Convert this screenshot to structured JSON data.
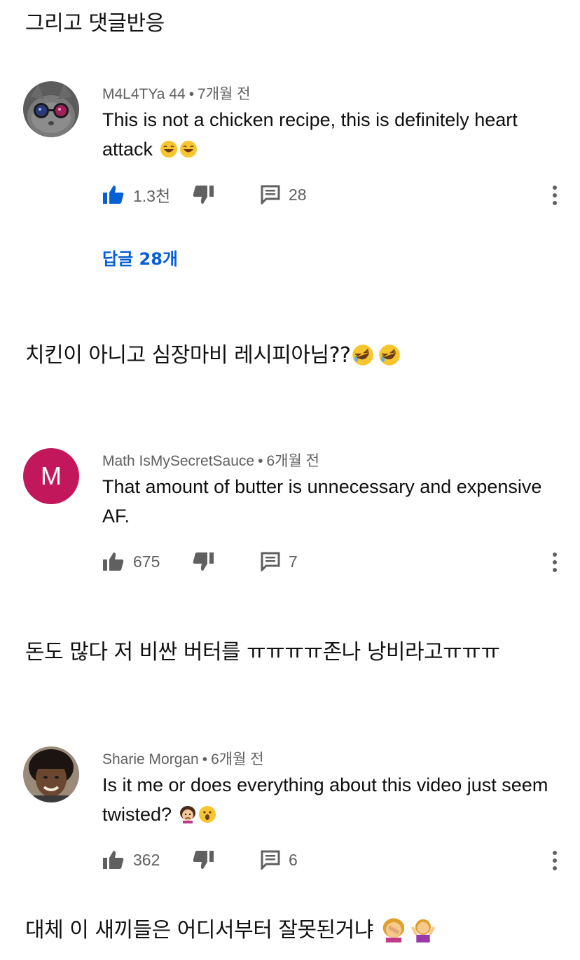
{
  "captions": [
    "그리고 댓글반응",
    "치킨이 아니고 심장마비 레시피아님??",
    "돈도 많다 저 비싼 버터를 ㅠㅠㅠㅠ존나 낭비라고ㅠㅠㅠ",
    "대체 이 새끼들은 어디서부터 잘못된거냐"
  ],
  "comments": [
    {
      "author": "M4L4TYa 44",
      "time": "7개월 전",
      "text": "This is not a chicken recipe, this is definitely heart attack",
      "emojis": [
        "grinning-sweat-emoji",
        "grinning-sweat-emoji"
      ],
      "likes": "1.3천",
      "replies_count": "28",
      "liked": true,
      "reply_link": "답글 28개",
      "avatar": "cat-with-sunglasses"
    },
    {
      "author": "Math IsMySecretSauce",
      "time": "6개월 전",
      "text": "That amount of butter is unnecessary and expensive AF.",
      "emojis": [],
      "likes": "675",
      "replies_count": "7",
      "liked": false,
      "avatar_letter": "M",
      "avatar_color": "#c2185b"
    },
    {
      "author": "Sharie Morgan",
      "time": "6개월 전",
      "text": "Is it me or does everything about this video just seem twisted?",
      "emojis": [
        "woman-pouting-emoji",
        "hushed-face-emoji"
      ],
      "likes": "362",
      "replies_count": "6",
      "liked": false,
      "avatar": "photo-portrait"
    }
  ],
  "colors": {
    "accent_blue": "#065fd4",
    "meta_gray": "#606060",
    "icon_gray": "#606060",
    "avatar_m": "#c2185b"
  },
  "icons": [
    "thumbs-up-icon",
    "thumbs-down-icon",
    "reply-icon",
    "more-vert-icon",
    "laughing-emoji",
    "rolling-laughing-emoji",
    "woman-facepalm-emoji",
    "woman-shrugging-emoji"
  ]
}
